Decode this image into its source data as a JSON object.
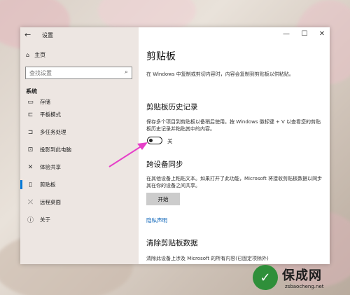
{
  "window": {
    "title": "设置",
    "back_glyph": "←",
    "minimize_glyph": "—",
    "maximize_glyph": "☐",
    "close_glyph": "✕"
  },
  "sidebar": {
    "home_label": "主页",
    "search_placeholder": "查找设置",
    "section_label": "系统",
    "items": [
      {
        "label": "存储",
        "icon": "storage-icon",
        "glyph": "▭"
      },
      {
        "label": "平板模式",
        "icon": "tablet-mode-icon",
        "glyph": "⊏"
      },
      {
        "label": "多任务处理",
        "icon": "multitasking-icon",
        "glyph": "⊐"
      },
      {
        "label": "投影到此电脑",
        "icon": "project-icon",
        "glyph": "⊡"
      },
      {
        "label": "体验共享",
        "icon": "shared-experiences-icon",
        "glyph": "✕"
      },
      {
        "label": "剪贴板",
        "icon": "clipboard-icon",
        "glyph": "▯"
      },
      {
        "label": "远程桌面",
        "icon": "remote-desktop-icon",
        "glyph": "⤫"
      },
      {
        "label": "关于",
        "icon": "info-icon",
        "glyph": "ⓘ"
      }
    ],
    "active_index": 5
  },
  "content": {
    "title": "剪贴板",
    "intro": "在 Windows 中复制或剪切内容时，内容会复制到剪贴板以供粘贴。",
    "history_heading": "剪贴板历史记录",
    "history_desc": "保存多个项目到剪贴板以备稍后使用。按 Windows 徽标键 + V 以查看您的剪贴板历史记录并粘贴其中的内容。",
    "history_toggle_state": "关",
    "history_toggle_on": false,
    "sync_heading": "跨设备同步",
    "sync_desc": "在其他设备上粘贴文本。如果打开了此功能，Microsoft 将接收剪贴板数据以同步其在你的设备之间共享。",
    "sync_button": "开始",
    "privacy_link": "隐私声明",
    "clear_heading": "清除剪贴板数据",
    "clear_desc": "清除此设备上涉及 Microsoft 的所有内容(已固定项除外)"
  },
  "annotation": {
    "arrow_color": "#e640c8"
  },
  "watermark": {
    "brand": "保成网",
    "url": "zsbaocheng.net",
    "logo_color": "#2f8f3a"
  }
}
